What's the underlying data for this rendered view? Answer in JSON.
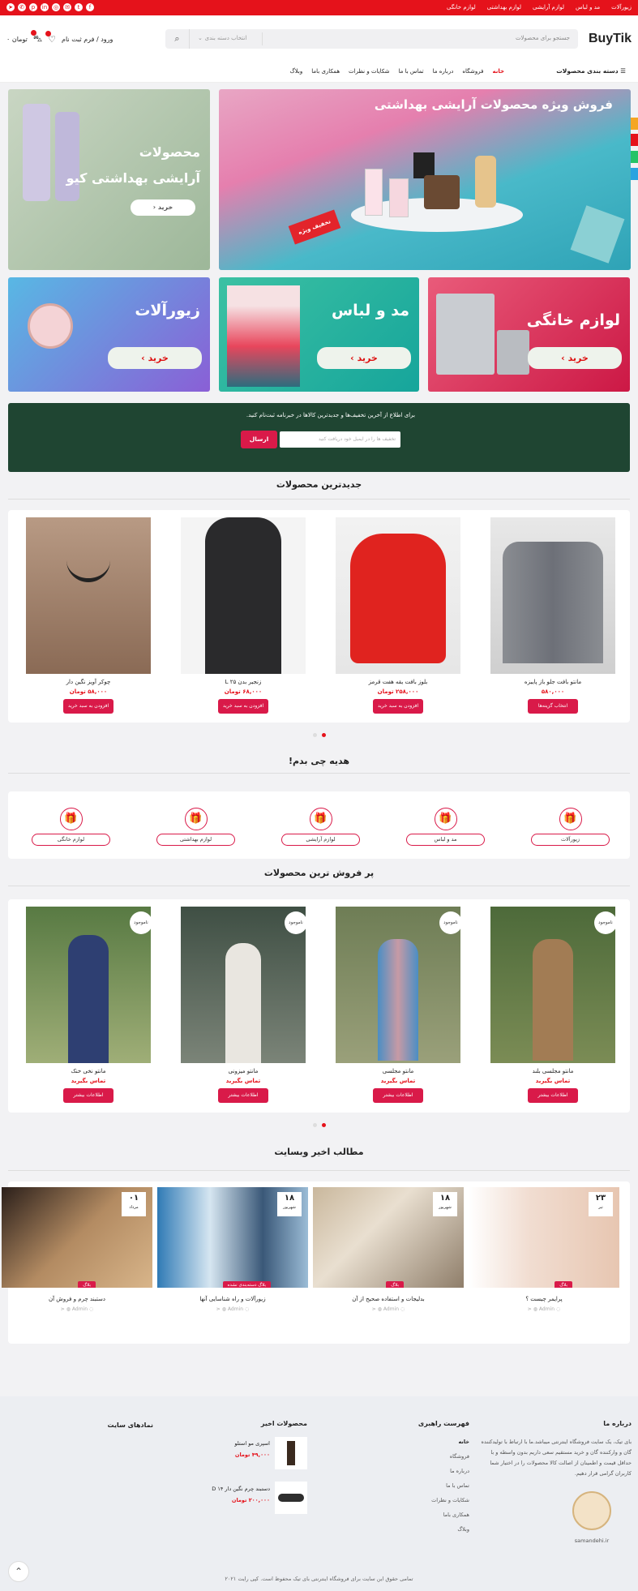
{
  "topbar": {
    "links": [
      "زیورآلات",
      "مد و لباس",
      "لوازم آرایشی",
      "لوازم بهداشتی",
      "لوازم خانگی"
    ],
    "social_icons": [
      "facebook-icon",
      "twitter-icon",
      "email-icon",
      "instagram-icon",
      "linkedin-icon",
      "pinterest-icon",
      "whatsapp-icon",
      "telegram-icon"
    ]
  },
  "header": {
    "logo": "BuyTik",
    "search_placeholder": "جستجو برای محصولات",
    "category_select": "انتخاب دسته بندی",
    "account_label": "ورود / فرم ثبت نام",
    "cart_total": "۰ تومان"
  },
  "nav": {
    "categories_label": "دسته بندی محصولات",
    "items": [
      "خانه",
      "فروشگاه",
      "درباره ما",
      "تماس با ما",
      "شکایات و نظرات",
      "همکاری باما",
      "وبلاگ"
    ]
  },
  "banners": {
    "main_title": "فروش ویژه محصولات آرایشی بهداشتی",
    "main_sticker": "تخفیف ویژه",
    "kyo_title_1": "محصولات",
    "kyo_title_2": "آرایشی بهداشتی کیو",
    "kyo_button": "خرید",
    "jewelry_title": "زیورآلات",
    "fashion_title": "مد و لباس",
    "home_title": "لوازم خانگی",
    "buy_button": "خرید"
  },
  "newsletter": {
    "text": "برای اطلاع از آخرین تخفیف‌ها و جدیدترین کالاها در خبرنامه ثبت‌نام کنید.",
    "placeholder": "تخفیف ها را در ایمیل خود دریافت کنید",
    "button": "ارسال"
  },
  "newest": {
    "title": "جدیدترین محصولات",
    "products": [
      {
        "name": "مانتو بافت جلو باز پاییزه",
        "price": "۵۸۰,۰۰۰",
        "button": "انتخاب گزینه‌ها"
      },
      {
        "name": "بلوز بافت یقه هفت قرمز",
        "price": "۲۵۸,۰۰۰ تومان",
        "button": "افزودن به سبد خرید"
      },
      {
        "name": "زنجیر بدن ۲۵ L",
        "price": "۶۸,۰۰۰ تومان",
        "button": "افزودن به سبد خرید"
      },
      {
        "name": "چوکر آویز نگین دار",
        "price": "۵۸,۰۰۰ تومان",
        "button": "افزودن به سبد خرید"
      }
    ]
  },
  "gift": {
    "title": "هدیه چی بدم!",
    "categories": [
      "زیورآلات",
      "مد و لباس",
      "لوازم آرایشی",
      "لوازم بهداشتی",
      "لوازم خانگی"
    ]
  },
  "best": {
    "title": "پر فروش ترین محصولات",
    "badge": "ناموجود",
    "products": [
      {
        "name": "مانتو مجلسی بلند",
        "price": "تماس بگیرید",
        "button": "اطلاعات بیشتر"
      },
      {
        "name": "مانتو مجلسی",
        "price": "تماس بگیرید",
        "button": "اطلاعات بیشتر"
      },
      {
        "name": "مانتو میزونی",
        "price": "تماس بگیرید",
        "button": "اطلاعات بیشتر"
      },
      {
        "name": "مانتو نخی خنک",
        "price": "تماس بگیرید",
        "button": "اطلاعات بیشتر"
      }
    ]
  },
  "blog": {
    "title": "مطالب اخیر وبسایت",
    "author": "Admin",
    "posts": [
      {
        "day": "۲۳",
        "month": "تیر",
        "tag": "بلاگ",
        "title": "پرایمر چیست ؟"
      },
      {
        "day": "۱۸",
        "month": "شهریور",
        "tag": "بلاگ",
        "title": "بدلیجات و استفاده صحیح از آن"
      },
      {
        "day": "۱۸",
        "month": "شهریور",
        "tag": "بلاگ دسته‌بندی نشده",
        "title": "زیورآلات و راه شناسایی آنها"
      },
      {
        "day": "۰۱",
        "month": "مرداد",
        "tag": "بلاگ",
        "title": "دستبند چرم و فروش آن"
      }
    ]
  },
  "footer": {
    "about_title": "درباره ما",
    "about_text": "بای تیک، یک سایت فروشگاه اینترنتی میباشد.ما با ارتباط با تولیدکننده گان و وارکننده گان و خرید مستقیم سعی داریم بدون واسطه و با حداقل قیمت و اطمینان از اصالت کالا محصولات را در اختیار شما کاربران گرامی قرار دهیم.",
    "samandehi_label": "samandehi.ir",
    "guide_title": "فهرست راهبری",
    "guide_links": [
      "خانه",
      "فروشگاه",
      "درباره ما",
      "تماس با ما",
      "شکایات و نظرات",
      "همکاری باما",
      "وبلاگ"
    ],
    "products_title": "محصولات اخیر",
    "products": [
      {
        "name": "اسپری مو استلو",
        "price": "۴۹,۰۰۰ تومان"
      },
      {
        "name": "دستبند چرم نگین دار D ۱۴",
        "price": "۲۰۰,۰۰۰ تومان"
      }
    ],
    "symbols_title": "نمادهای سایت",
    "copyright": "تمامی حقوق این سایت برای فروشگاه اینترنتی بای تیک محفوظ است. کپی رایت ۲۰۲۱"
  }
}
